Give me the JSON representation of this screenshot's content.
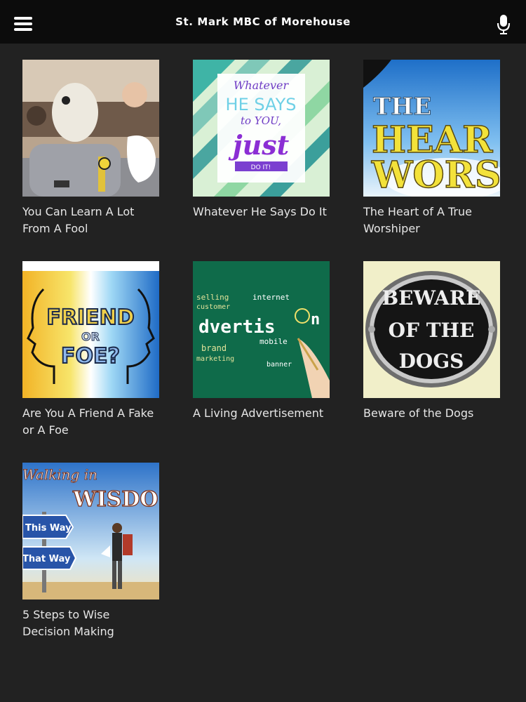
{
  "header": {
    "title": "St. Mark MBC of Morehouse",
    "menu_icon": "hamburger-menu-icon",
    "mic_icon": "microphone-icon"
  },
  "sermons": [
    {
      "title": "You Can Learn A Lot From A Fool",
      "image": "crash-test-dummy"
    },
    {
      "title": "Whatever He Says Do It",
      "image": "whatever-he-says-graphic",
      "art_text": [
        "Whatever",
        "HE SAYS",
        "to YOU,",
        "just",
        "DO IT!"
      ]
    },
    {
      "title": "The Heart of A True Worshiper",
      "image": "heart-worship-graphic",
      "art_text": [
        "THE",
        "HEAR",
        "WORS"
      ]
    },
    {
      "title": "Are You A Friend A Fake or A Foe",
      "image": "friend-or-foe-graphic",
      "art_text": [
        "FRIEND",
        "OR",
        "FOE?"
      ]
    },
    {
      "title": "A Living Advertisement",
      "image": "advertising-chalkboard",
      "art_text": [
        "dvertis",
        "n",
        "selling",
        "customer",
        "internet",
        "mobile",
        "brand",
        "marketing",
        "banner"
      ]
    },
    {
      "title": "Beware of the Dogs",
      "image": "beware-of-dogs-sign",
      "art_text": [
        "BEWARE",
        "OF THE",
        "DOGS"
      ]
    },
    {
      "title": "5 Steps to Wise Decision Making",
      "image": "walking-in-wisdom-graphic",
      "art_text": [
        "Walking in",
        "WISDO",
        "This Way",
        "That Way"
      ]
    }
  ],
  "colors": {
    "background": "#222222",
    "header_bg": "#0c0c0c",
    "title_text": "#ffffff",
    "card_text": "#e6e6e6"
  }
}
